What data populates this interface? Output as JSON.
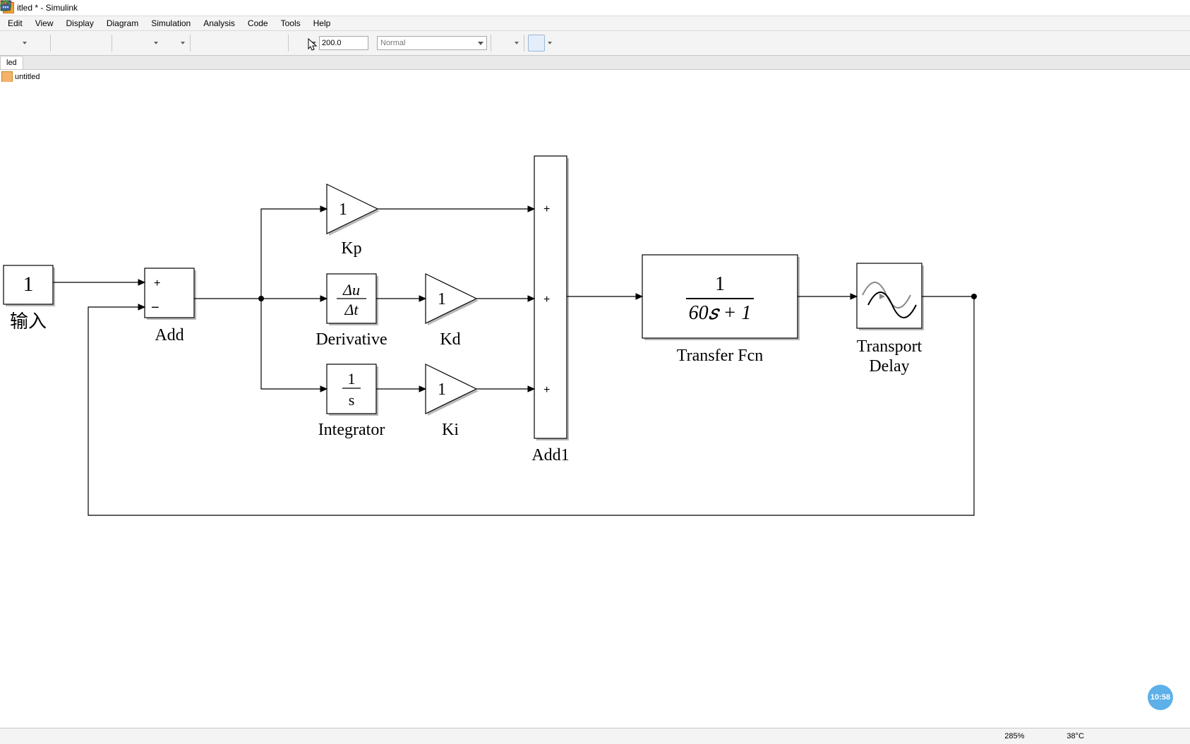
{
  "window": {
    "title": "itled * - Simulink"
  },
  "menu": {
    "items": [
      "Edit",
      "View",
      "Display",
      "Diagram",
      "Simulation",
      "Analysis",
      "Code",
      "Tools",
      "Help"
    ]
  },
  "toolbar": {
    "stop_time": "200.0",
    "mode": "Normal"
  },
  "tabs": {
    "active": "led"
  },
  "breadcrumb": {
    "model": "untitled"
  },
  "blocks": {
    "input": {
      "value": "1",
      "label": "输入"
    },
    "add": {
      "label": "Add",
      "signs": [
        "+",
        "−"
      ]
    },
    "kp": {
      "gain": "1",
      "label": "Kp"
    },
    "deriv": {
      "top": "Δu",
      "bot": "Δt",
      "label": "Derivative"
    },
    "kd": {
      "gain": "1",
      "label": "Kd"
    },
    "integ": {
      "top": "1",
      "bot": "s",
      "label": "Integrator"
    },
    "ki": {
      "gain": "1",
      "label": "Ki"
    },
    "add1": {
      "label": "Add1",
      "signs": [
        "+",
        "+",
        "+"
      ]
    },
    "tf": {
      "num": "1",
      "den": "60𝑠 + 1",
      "label": "Transfer Fcn"
    },
    "delay": {
      "label": "Transport",
      "label2": "Delay"
    }
  },
  "status": {
    "zoom": "285%",
    "temp": "38°C"
  },
  "overlay": {
    "clock": "10:58"
  }
}
